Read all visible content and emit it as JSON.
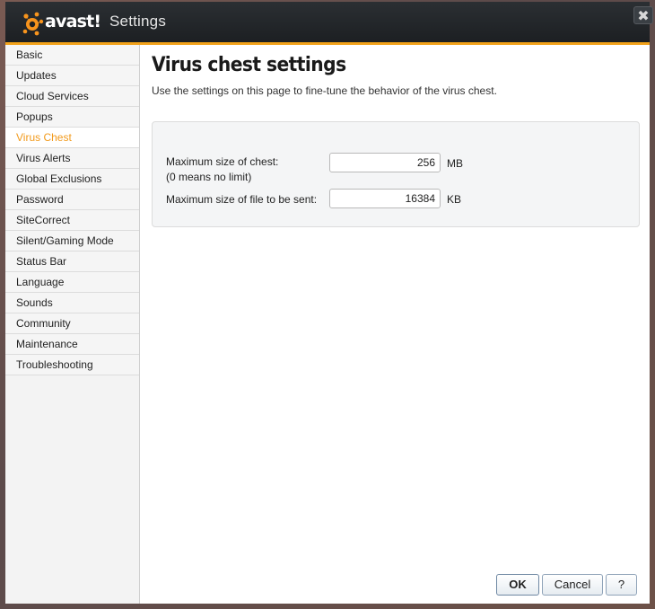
{
  "window": {
    "title": "Settings",
    "close_glyph": "✖"
  },
  "logo": {
    "name": "avast-logo",
    "text": "avast!"
  },
  "sidebar": {
    "items": [
      {
        "label": "Basic"
      },
      {
        "label": "Updates"
      },
      {
        "label": "Cloud Services"
      },
      {
        "label": "Popups"
      },
      {
        "label": "Virus Chest",
        "active": true
      },
      {
        "label": "Virus Alerts"
      },
      {
        "label": "Global Exclusions"
      },
      {
        "label": "Password"
      },
      {
        "label": "SiteCorrect"
      },
      {
        "label": "Silent/Gaming Mode"
      },
      {
        "label": "Status Bar"
      },
      {
        "label": "Language"
      },
      {
        "label": "Sounds"
      },
      {
        "label": "Community"
      },
      {
        "label": "Maintenance"
      },
      {
        "label": "Troubleshooting"
      }
    ]
  },
  "main": {
    "title": "Virus chest settings",
    "description": "Use the settings on this page to fine-tune the behavior of the virus chest.",
    "max_chest": {
      "label": "Maximum size of chest:",
      "hint": "(0 means no limit)",
      "value": "256",
      "unit": "MB"
    },
    "max_file": {
      "label": "Maximum size of file to be sent:",
      "value": "16384",
      "unit": "KB"
    }
  },
  "buttons": {
    "ok": "OK",
    "cancel": "Cancel",
    "help": "?"
  },
  "colors": {
    "accent": "#f2a21a",
    "active_item": "#f29a1b",
    "titlebar": "#1c1f22"
  }
}
